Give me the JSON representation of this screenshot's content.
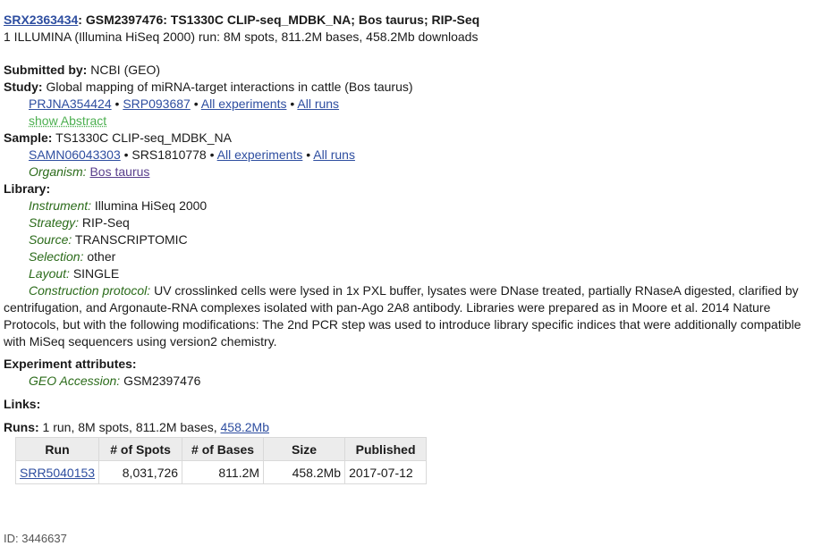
{
  "header": {
    "accession": "SRX2363434",
    "title_rest": ": GSM2397476: TS1330C CLIP-seq_MDBK_NA; Bos taurus; RIP-Seq",
    "run_summary": "1 ILLUMINA (Illumina HiSeq 2000) run: 8M spots, 811.2M bases, 458.2Mb downloads"
  },
  "submitted": {
    "label": "Submitted by:",
    "value": " NCBI (GEO)"
  },
  "study": {
    "label": "Study:",
    "value": " Global mapping of miRNA-target interactions in cattle (Bos taurus)",
    "bioproject": "PRJNA354424",
    "srp": "SRP093687",
    "all_experiments": "All experiments",
    "all_runs": "All runs",
    "bullet": " • ",
    "show_abstract": "show Abstract"
  },
  "sample": {
    "label": "Sample:",
    "value": " TS1330C CLIP-seq_MDBK_NA",
    "biosample": "SAMN06043303",
    "srs": " • SRS1810778 • ",
    "all_experiments": "All experiments",
    "all_runs": "All runs",
    "bullet": " • ",
    "organism_label": "Organism:",
    "organism_value": "Bos taurus"
  },
  "library": {
    "label": "Library:",
    "instrument_label": "Instrument:",
    "instrument_value": " Illumina HiSeq 2000",
    "strategy_label": "Strategy:",
    "strategy_value": " RIP-Seq",
    "source_label": "Source:",
    "source_value": " TRANSCRIPTOMIC",
    "selection_label": "Selection:",
    "selection_value": " other",
    "layout_label": "Layout:",
    "layout_value": " SINGLE",
    "protocol_label": "Construction protocol:",
    "protocol_line1": " UV crosslinked cells were lysed in 1x PXL buffer, lysates were DNase treated, partially RNaseA digested, clarified by",
    "protocol_line2": "centrifugation, and Argonaute-RNA complexes isolated with pan-Ago 2A8 antibody. Libraries were prepared as in Moore et al. 2014 Nature",
    "protocol_line3": "Protocols, but with the following modifications: The 2nd PCR step was used to introduce library specific indices that were additionally compatible",
    "protocol_line4": "with MiSeq sequencers using version2 chemistry."
  },
  "attributes": {
    "label": "Experiment attributes:",
    "geo_label": "GEO Accession:",
    "geo_value": " GSM2397476"
  },
  "links": {
    "label": "Links:"
  },
  "runs": {
    "label": "Runs:",
    "summary": " 1 run, 8M spots, 811.2M bases, ",
    "download_link": "458.2Mb",
    "columns": [
      "Run",
      "# of Spots",
      "# of Bases",
      "Size",
      "Published"
    ],
    "rows": [
      {
        "run": "SRR5040153",
        "spots": "8,031,726",
        "bases": "811.2M",
        "size": "458.2Mb",
        "published": "2017-07-12"
      }
    ]
  },
  "footer": {
    "id_text": "ID: 3446637"
  },
  "colors": {
    "link": "#2e4ea0",
    "label_green": "#2b6b1a",
    "abstract_green": "#4caf50",
    "table_header_bg": "#ececec"
  }
}
